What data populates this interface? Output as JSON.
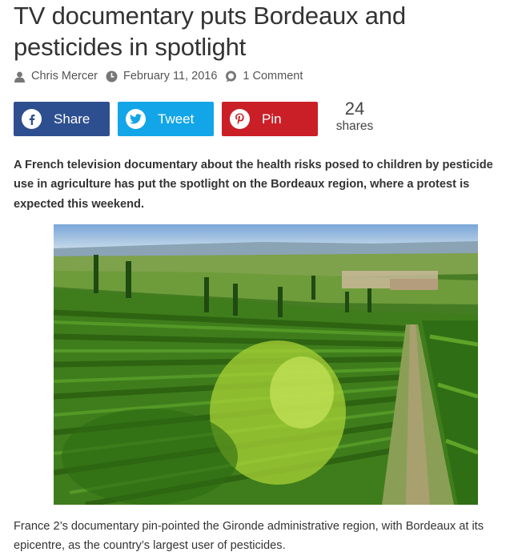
{
  "article": {
    "title": "TV documentary puts Bordeaux and pesticides in spotlight",
    "author": "Chris Mercer",
    "date": "February 11, 2016",
    "comments": "1 Comment",
    "lead": "A French television documentary about the health risks posed to children by pesticide use in agriculture has put the spotlight on the Bordeaux region, where a protest is expected this weekend.",
    "caption": "France 2’s documentary pin-pointed the Gironde administrative region, with Bordeaux at its epicentre, as the country’s largest user of pesticides."
  },
  "share": {
    "facebook_label": "Share",
    "twitter_label": "Tweet",
    "pinterest_label": "Pin",
    "count": "24",
    "count_label": "shares",
    "colors": {
      "facebook": "#2e4f8f",
      "twitter": "#12a5e8",
      "pinterest": "#cb1f27"
    }
  },
  "icons": {
    "author": "user-icon",
    "date": "clock-icon",
    "comments": "comment-icon",
    "facebook": "facebook-icon",
    "twitter": "twitter-icon",
    "pinterest": "pinterest-icon"
  }
}
